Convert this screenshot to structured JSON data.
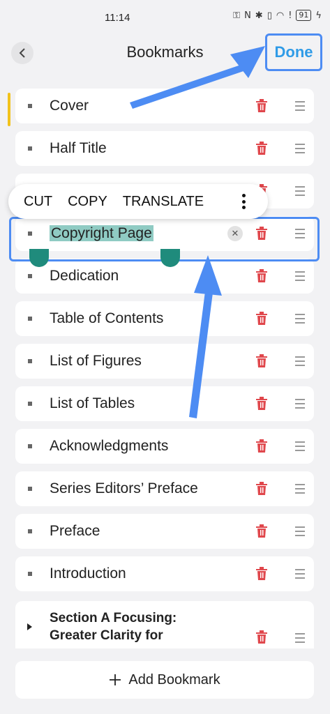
{
  "status_bar": {
    "time": "11:14",
    "battery": "91"
  },
  "header": {
    "back_icon": "chevron-left-icon",
    "title": "Bookmarks",
    "done_label": "Done"
  },
  "context_menu": {
    "items": [
      "CUT",
      "COPY",
      "TRANSLATE"
    ],
    "more_icon": "more-vertical-icon"
  },
  "bookmarks": [
    {
      "label": "Cover"
    },
    {
      "label": "Half Title"
    },
    {
      "label": ""
    },
    {
      "label": "Copyright Page"
    },
    {
      "label": "Dedication"
    },
    {
      "label": "Table of Contents"
    },
    {
      "label": "List of Figures"
    },
    {
      "label": "List of Tables"
    },
    {
      "label": "Acknowledgments"
    },
    {
      "label": "Series Editors’ Preface"
    },
    {
      "label": "Preface"
    },
    {
      "label": "Introduction"
    }
  ],
  "section": {
    "label_line1": "Section A Focusing:",
    "label_line2": "Greater Clarity for"
  },
  "add_button": {
    "icon": "plus-icon",
    "label": "Add Bookmark"
  },
  "colors": {
    "accent": "#4d8cf3",
    "done_text": "#2f9be7",
    "trash": "#e0474c",
    "selection": "#8fcbc3",
    "handle": "#1f8b7c",
    "active_marker": "#f2c21b"
  }
}
